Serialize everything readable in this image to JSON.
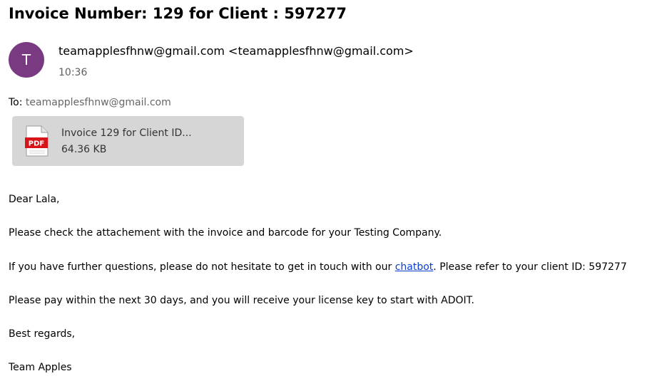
{
  "email": {
    "subject": "Invoice Number: 129 for Client : 597277",
    "avatar_initial": "T",
    "avatar_color": "#7a3a82",
    "sender": "teamapplesfhnw@gmail.com <teamapplesfhnw@gmail.com>",
    "time": "10:36",
    "to_label": "To:",
    "to_address": "teamapplesfhnw@gmail.com"
  },
  "attachment": {
    "icon": "pdf-file-icon",
    "icon_text": "PDF",
    "name": "Invoice 129 for Client ID...",
    "size": "64.36 KB"
  },
  "body": {
    "greeting": "Dear Lala,",
    "line1": "Please check the attachement with the invoice and barcode for your Testing Company.",
    "line2_before": "If you have further questions, please do not hesitate to get in touch with our ",
    "line2_link": "chatbot",
    "line2_after": ". Please refer to your client ID: 597277",
    "line3": "Please pay within the next 30 days, and you will receive your license key to start with ADOIT.",
    "closing": "Best regards,",
    "signature": "Team Apples"
  },
  "colors": {
    "link": "#0b3fd1",
    "attachment_bg": "#d6d6d6",
    "pdf_red": "#d7141a"
  }
}
